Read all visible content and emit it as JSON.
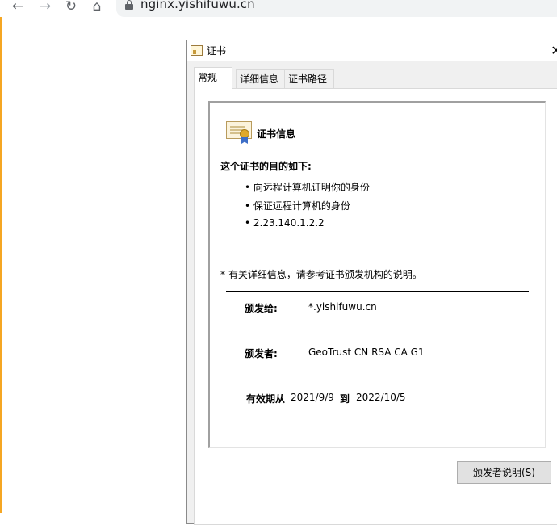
{
  "browser": {
    "url": "nginx.yishifuwu.cn",
    "back_glyph": "←",
    "forward_glyph": "→",
    "reload_glyph": "↻",
    "home_glyph": "⌂"
  },
  "dialog": {
    "title": "证书",
    "close_glyph": "✕",
    "tabs": [
      {
        "label": "常规",
        "active": true
      },
      {
        "label": "详细信息",
        "active": false
      },
      {
        "label": "证书路径",
        "active": false
      }
    ],
    "general": {
      "heading": "证书信息",
      "purpose_title": "这个证书的目的如下:",
      "purposes": [
        "• 向远程计算机证明你的身份",
        "• 保证远程计算机的身份",
        "• 2.23.140.1.2.2"
      ],
      "note": "* 有关详细信息，请参考证书颁发机构的说明。",
      "issued_to_label": "颁发给:",
      "issued_to_value": "*.yishifuwu.cn",
      "issued_by_label": "颁发者:",
      "issued_by_value": "GeoTrust CN RSA CA G1",
      "valid_from_label": "有效期从",
      "valid_from_value": "2021/9/9",
      "valid_to_label": "到",
      "valid_to_value": "2022/10/5"
    },
    "issuer_statement_button": "颁发者说明(S)"
  },
  "colors": {
    "accent_edge": "#f5a623",
    "dialog_bg": "#f0f0f0",
    "button_bg": "#e1e1e1"
  }
}
